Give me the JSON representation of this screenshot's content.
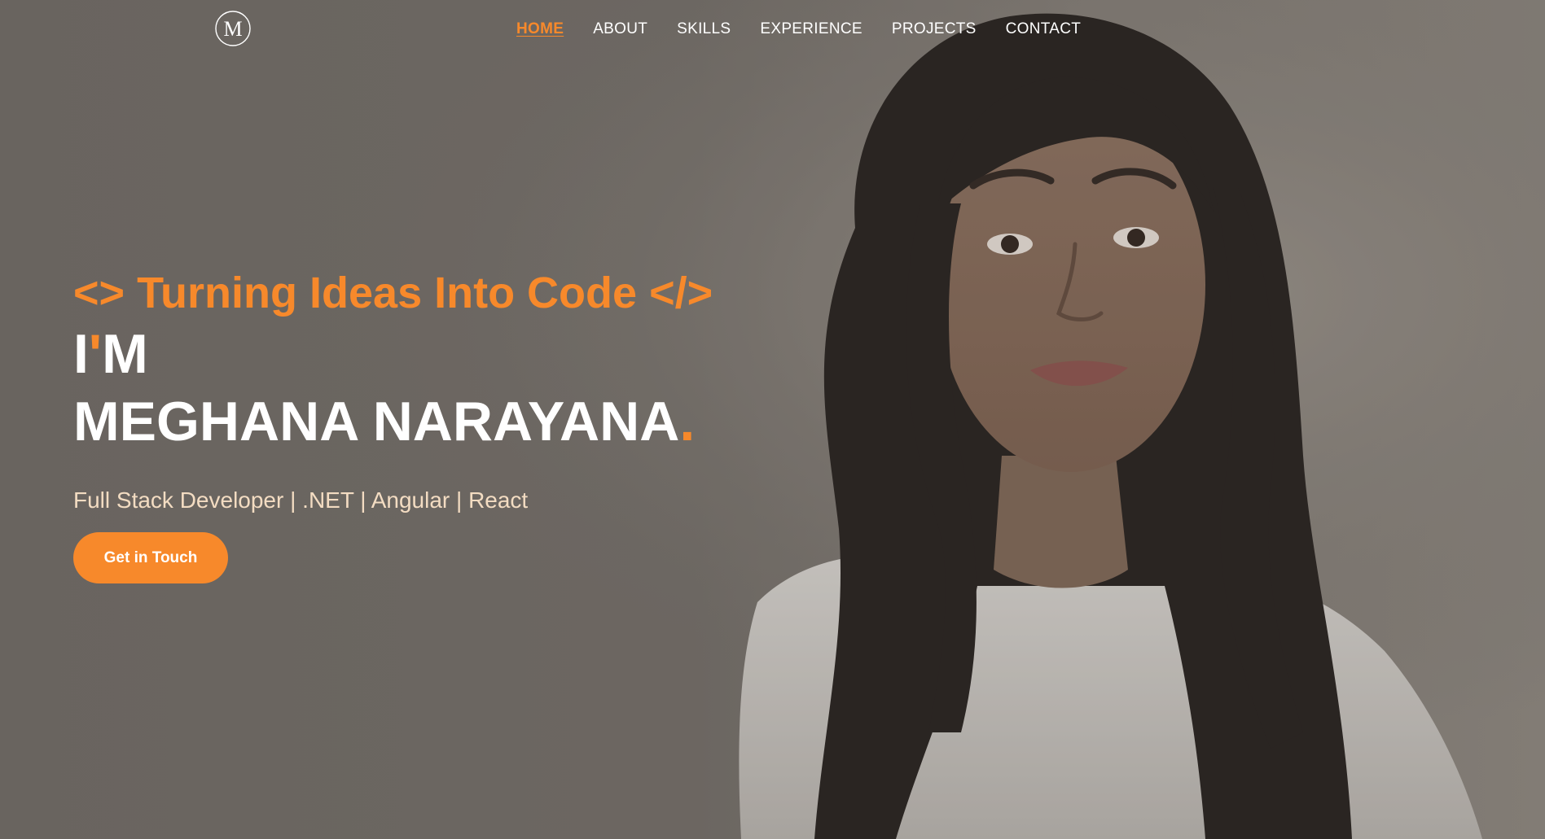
{
  "colors": {
    "accent": "#f7892b",
    "text": "#ffffff",
    "subtitle": "#f3dcc2",
    "background": "#6f6a65"
  },
  "logo": {
    "letter": "M"
  },
  "nav": {
    "items": [
      {
        "label": "HOME",
        "active": true
      },
      {
        "label": "ABOUT",
        "active": false
      },
      {
        "label": "SKILLS",
        "active": false
      },
      {
        "label": "EXPERIENCE",
        "active": false
      },
      {
        "label": "PROJECTS",
        "active": false
      },
      {
        "label": "CONTACT",
        "active": false
      }
    ]
  },
  "hero": {
    "tagline": "<> Turning Ideas Into Code </>",
    "greeting_i": "I",
    "greeting_apos": "'",
    "greeting_m": "M",
    "name": "MEGHANA NARAYANA",
    "name_dot": ".",
    "subtitle": "Full Stack Developer | .NET | Angular | React",
    "cta_label": "Get in Touch"
  },
  "image": {
    "icon": "portrait-photo"
  }
}
